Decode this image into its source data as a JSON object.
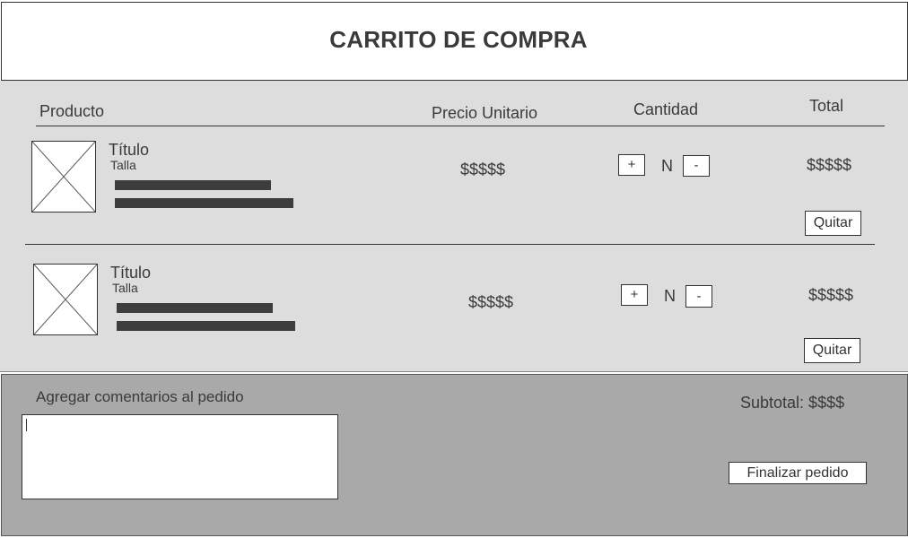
{
  "header": {
    "title": "CARRITO DE COMPRA"
  },
  "columns": {
    "product": "Producto",
    "unit_price": "Precio Unitario",
    "quantity": "Cantidad",
    "total": "Total"
  },
  "items": [
    {
      "title": "Título",
      "size": "Talla",
      "unit_price": "$$$$$",
      "increment_label": "+",
      "quantity": "N",
      "decrement_label": "-",
      "total": "$$$$$",
      "remove_label": "Quitar"
    },
    {
      "title": "Título",
      "size": "Talla",
      "unit_price": "$$$$$",
      "increment_label": "+",
      "quantity": "N",
      "decrement_label": "-",
      "total": "$$$$$",
      "remove_label": "Quitar"
    }
  ],
  "footer": {
    "comments_label": "Agregar comentarios al pedido",
    "comments_value": "",
    "subtotal": "Subtotal: $$$$",
    "checkout_label": "Finalizar pedido"
  },
  "colors": {
    "header_bg": "#ffffff",
    "cart_bg": "#dddddd",
    "footer_bg": "#a9a9a9",
    "text": "#3a3a3a",
    "placeholder_bar": "#3d3d3d"
  }
}
